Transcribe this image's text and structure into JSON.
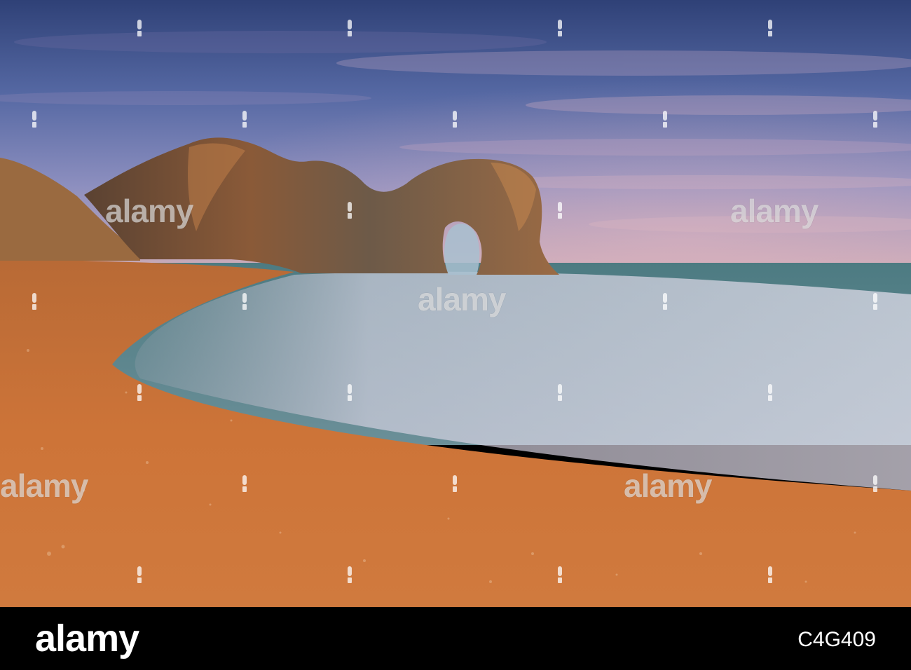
{
  "watermark": {
    "text": "alamy"
  },
  "footer": {
    "logo": "alamy",
    "image_id": "C4G409"
  },
  "colors": {
    "sky_top": "#3a4e8c",
    "sky_mid": "#8a8ab8",
    "sky_horizon": "#c9a9b5",
    "sea": "#4f7f84",
    "foam": "#d9d3e4",
    "beach": "#c86e34",
    "rock": "#5b4a3a",
    "footer_bg": "#000000"
  }
}
